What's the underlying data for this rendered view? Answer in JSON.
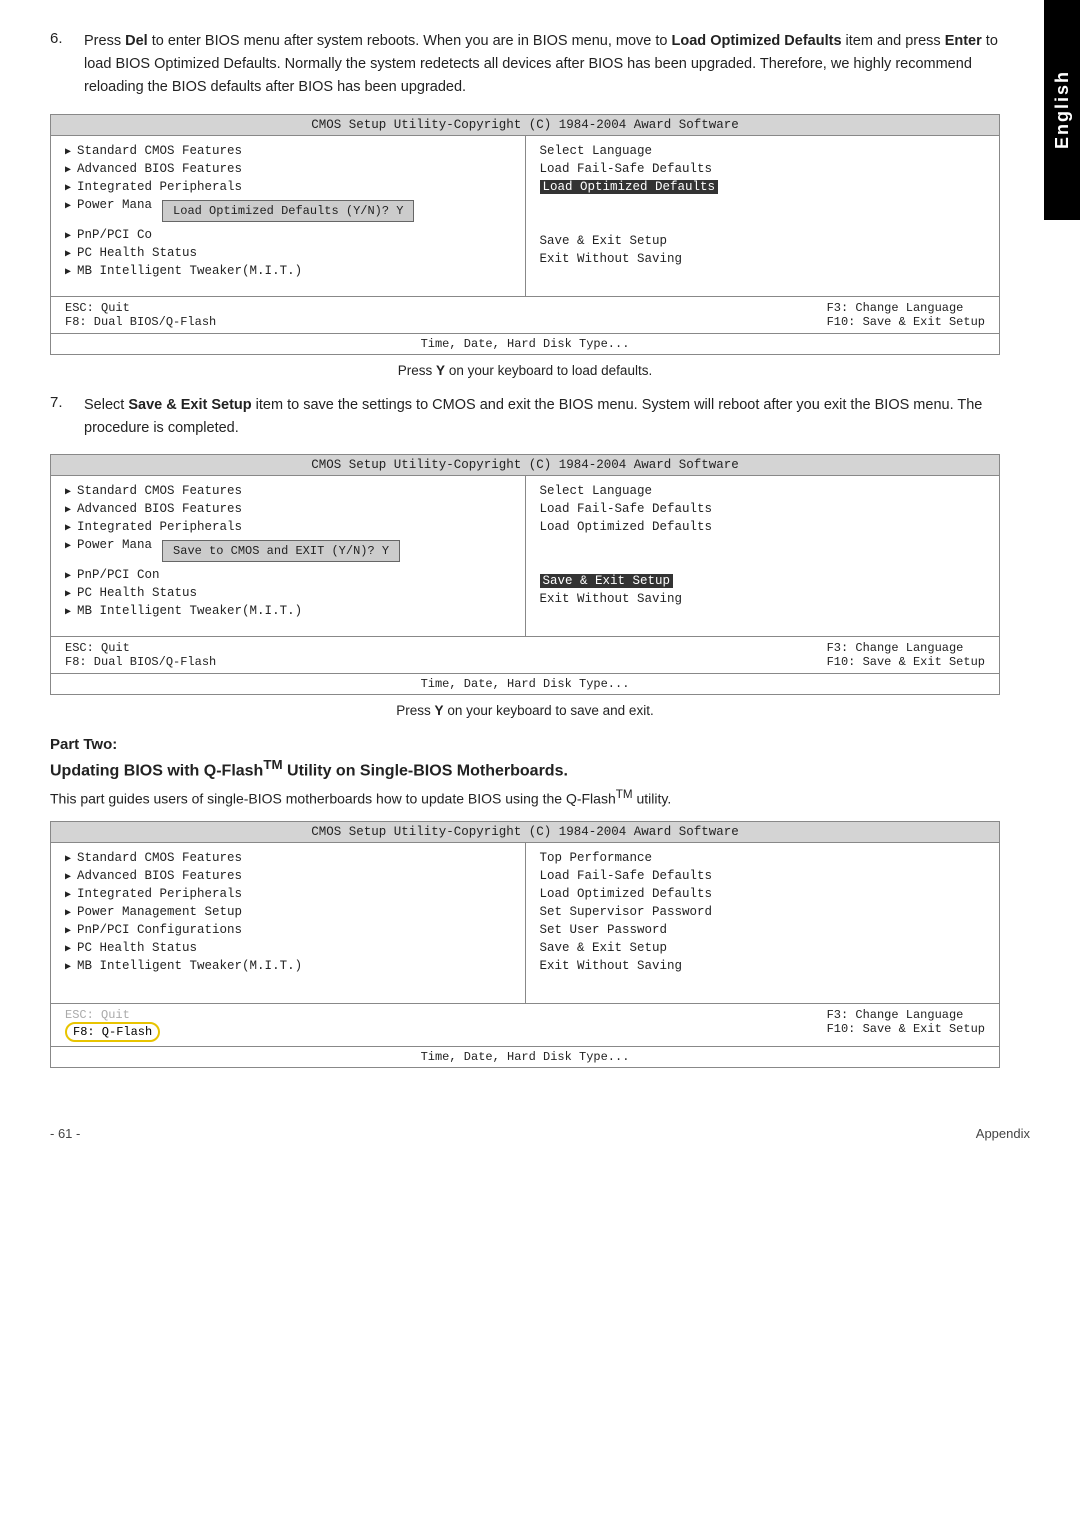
{
  "english_tab": "English",
  "steps": {
    "step6": {
      "num": "6.",
      "text_plain": "Press ",
      "del_key": "Del",
      "text2": " to enter BIOS menu after system reboots. When you are in BIOS menu, move to ",
      "load_defaults": "Load Optimized Defaults",
      "text3": " item and press ",
      "enter_key": "Enter",
      "text4": " to load BIOS Optimized Defaults. Normally the system redetects all devices after BIOS has been upgraded. Therefore, we highly recommend reloading the BIOS defaults after BIOS has been upgraded."
    },
    "step7": {
      "num": "7.",
      "text": "Select ",
      "save_exit": "Save & Exit Setup",
      "text2": " item to save the settings to CMOS and exit the BIOS menu. System will reboot after you exit the BIOS menu. The procedure is completed."
    }
  },
  "bios1": {
    "title": "CMOS Setup Utility-Copyright (C) 1984-2004 Award Software",
    "left_items": [
      "Standard CMOS Features",
      "Advanced BIOS Features",
      "Integrated Peripherals",
      "Power Mana...",
      "PnP/PCI Co...",
      "PC Health Status",
      "MB Intelligent Tweaker(M.I.T.)"
    ],
    "right_items": [
      "Select Language",
      "Load Fail-Safe Defaults",
      "Load Optimized Defaults",
      "",
      "",
      "Save & Exit Setup",
      "Exit Without Saving"
    ],
    "popup_text": "Load Optimized Defaults (Y/N)? Y",
    "footer_left": "ESC: Quit",
    "footer_left2": "F8: Dual BIOS/Q-Flash",
    "footer_right": "F3: Change Language",
    "footer_right2": "F10: Save & Exit Setup",
    "bottom": "Time, Date, Hard Disk Type..."
  },
  "caption1": {
    "text": "Press ",
    "bold": "Y",
    "text2": " on your keyboard to load defaults."
  },
  "bios2": {
    "title": "CMOS Setup Utility-Copyright (C) 1984-2004 Award Software",
    "left_items": [
      "Standard CMOS Features",
      "Advanced BIOS Features",
      "Integrated Peripherals",
      "Power Mana...",
      "PnP/PCI Con...",
      "PC Health Status",
      "MB Intelligent Tweaker(M.I.T.)"
    ],
    "right_items": [
      "Select Language",
      "Load Fail-Safe Defaults",
      "Load Optimized Defaults",
      "",
      "",
      "Save & Exit Setup",
      "Exit Without Saving"
    ],
    "popup_text": "Save to CMOS and EXIT (Y/N)? Y",
    "footer_left": "ESC: Quit",
    "footer_left2": "F8: Dual BIOS/Q-Flash",
    "footer_right": "F3: Change Language",
    "footer_right2": "F10: Save & Exit Setup",
    "bottom": "Time, Date, Hard Disk Type..."
  },
  "caption2": {
    "text": "Press ",
    "bold": "Y",
    "text2": " on your keyboard to save and exit."
  },
  "part_two": {
    "label": "Part Two:",
    "title": "Updating BIOS with Q-Flash™ Utility on Single-BIOS Motherboards.",
    "desc": "This part guides users of single-BIOS motherboards how to update BIOS using the Q-Flash™ utility."
  },
  "bios3": {
    "title": "CMOS Setup Utility-Copyright (C) 1984-2004 Award Software",
    "left_items": [
      "Standard CMOS Features",
      "Advanced BIOS Features",
      "Integrated Peripherals",
      "Power Management Setup",
      "PnP/PCI Configurations",
      "PC Health Status",
      "MB Intelligent Tweaker(M.I.T.)"
    ],
    "right_items": [
      "Top Performance",
      "Load Fail-Safe Defaults",
      "Load Optimized Defaults",
      "Set Supervisor Password",
      "Set User Password",
      "Save & Exit Setup",
      "Exit Without Saving"
    ],
    "footer_left": "ESC: Quit",
    "footer_left2": "F8: Q-Flash",
    "footer_right": "F3: Change Language",
    "footer_right2": "F10: Save & Exit Setup",
    "bottom": "Time, Date, Hard Disk Type..."
  },
  "page_footer": {
    "page_num": "- 61 -",
    "appendix": "Appendix"
  }
}
